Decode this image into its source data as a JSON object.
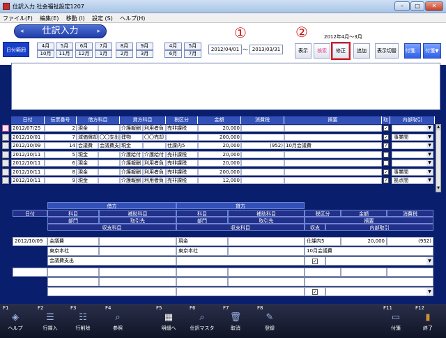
{
  "window": {
    "title": "仕訳入力 社会福祉設定1207"
  },
  "menu": {
    "file": "ファイル(F)",
    "edit": "編集(E)",
    "move": "移動 (I)",
    "settings": "設定 (S)",
    "help": "ヘルプ(H)"
  },
  "mode": {
    "label": "仕訳入力",
    "left_arrow": "◂",
    "right_arrow": "▸"
  },
  "range": {
    "button": "日付範囲",
    "from": "2012/04/01",
    "tilde": "〜",
    "to": "2013/03/31",
    "caption": "2012年4月〜3月",
    "months_top": [
      "4月",
      "5月",
      "6月",
      "7月",
      "8月",
      "9月",
      "4月",
      "5月"
    ],
    "months_bottom": [
      "10月",
      "11月",
      "12月",
      "1月",
      "2月",
      "3月",
      "6月",
      "7月"
    ]
  },
  "annotations": {
    "one": "①",
    "two": "②"
  },
  "toolbar": {
    "display": "表示",
    "search": "検索",
    "modify": "修正",
    "add": "追加",
    "toggle": "表示切替",
    "fusen_off": "付箋…",
    "fusen": "付箋▼"
  },
  "table": {
    "headers": [
      "日付",
      "伝票番号",
      "借方科目",
      "貸方科目",
      "税区分",
      "金額",
      "消費税",
      "摘要",
      "取",
      "内部取引"
    ],
    "rows": [
      {
        "date": "2012/07/25",
        "no": "2",
        "d1": "現金",
        "d2": "",
        "c1": "介護報酬",
        "c2": "利用者負",
        "tax": "売非課税",
        "amt": "20,000",
        "ctax": "",
        "memo": "",
        "chk": true,
        "internal": ""
      },
      {
        "date": "2012/10/01",
        "no": "7",
        "d1": "減価償却",
        "d2": "〇〇支出",
        "c1": "建物",
        "c2": "〇〇売却",
        "tax": "",
        "amt": "200,000",
        "ctax": "",
        "memo": "",
        "chk": true,
        "internal": "事業間"
      },
      {
        "date": "2012/10/09",
        "no": "14",
        "d1": "会議費",
        "d2": "会議費支",
        "c1": "現金",
        "c2": "",
        "tax": "仕課内5",
        "amt": "20,000",
        "ctax": "(952)",
        "memo": "10月会議費",
        "chk": true,
        "internal": ""
      },
      {
        "date": "2012/10/11",
        "no": "5",
        "d1": "現金",
        "d2": "",
        "c1": "介護給付",
        "c2": "介護給付",
        "tax": "売非課税",
        "amt": "20,000",
        "ctax": "",
        "memo": "",
        "chk": false,
        "internal": ""
      },
      {
        "date": "2012/10/11",
        "no": "6",
        "d1": "現金",
        "d2": "",
        "c1": "介護報酬",
        "c2": "利用者負",
        "tax": "売非課税",
        "amt": "20,000",
        "ctax": "",
        "memo": "",
        "chk": false,
        "internal": ""
      },
      {
        "date": "2012/10/11",
        "no": "8",
        "d1": "現金",
        "d2": "",
        "c1": "介護報酬",
        "c2": "利用者負",
        "tax": "売非課税",
        "amt": "200,000",
        "ctax": "",
        "memo": "",
        "chk": true,
        "internal": "事業間"
      },
      {
        "date": "2012/10/11",
        "no": "9",
        "d1": "現金",
        "d2": "",
        "c1": "介護報酬",
        "c2": "利用者負",
        "tax": "売非課税",
        "amt": "12,000",
        "ctax": "",
        "memo": "",
        "chk": true,
        "internal": "拠点間"
      }
    ]
  },
  "detail": {
    "h_debit": "借方",
    "h_credit": "貸方",
    "h_date": "日付",
    "h_subject": "科目",
    "h_sub": "補助科目",
    "h_dept": "部門",
    "h_partner": "取引先",
    "h_payitem": "収支科目",
    "h_tax": "税区分",
    "h_amount": "金額",
    "h_ctax": "消費税",
    "h_summary": "摘要",
    "h_io": "収支",
    "h_internal": "内部取引",
    "date": "2012/10/09",
    "debit_subject": "会議費",
    "debit_dept": "東京本社",
    "debit_payitem": "会議費支出",
    "credit_subject": "現金",
    "credit_dept": "東京本社",
    "tax": "仕課内5",
    "amount": "20,000",
    "ctax": "(952)",
    "summary": "10月会議費"
  },
  "fkeys": [
    {
      "key": "F1",
      "label": "ヘルプ",
      "icon": "help-icon"
    },
    {
      "key": "F2",
      "label": "行挿入",
      "icon": "insert-row-icon"
    },
    {
      "key": "F3",
      "label": "行削除",
      "icon": "delete-row-icon"
    },
    {
      "key": "F4",
      "label": "参照",
      "icon": "magnifier-icon"
    },
    {
      "key": "F5",
      "label": "明細へ",
      "icon": "detail-icon"
    },
    {
      "key": "F6",
      "label": "仕訳マスタ",
      "icon": "magnifier-icon"
    },
    {
      "key": "F7",
      "label": "取消",
      "icon": "trash-icon"
    },
    {
      "key": "F8",
      "label": "登録",
      "icon": "register-icon"
    },
    {
      "key": "F11",
      "label": "付箋",
      "icon": "sticky-icon"
    },
    {
      "key": "F12",
      "label": "終了",
      "icon": "exit-door-icon"
    }
  ]
}
